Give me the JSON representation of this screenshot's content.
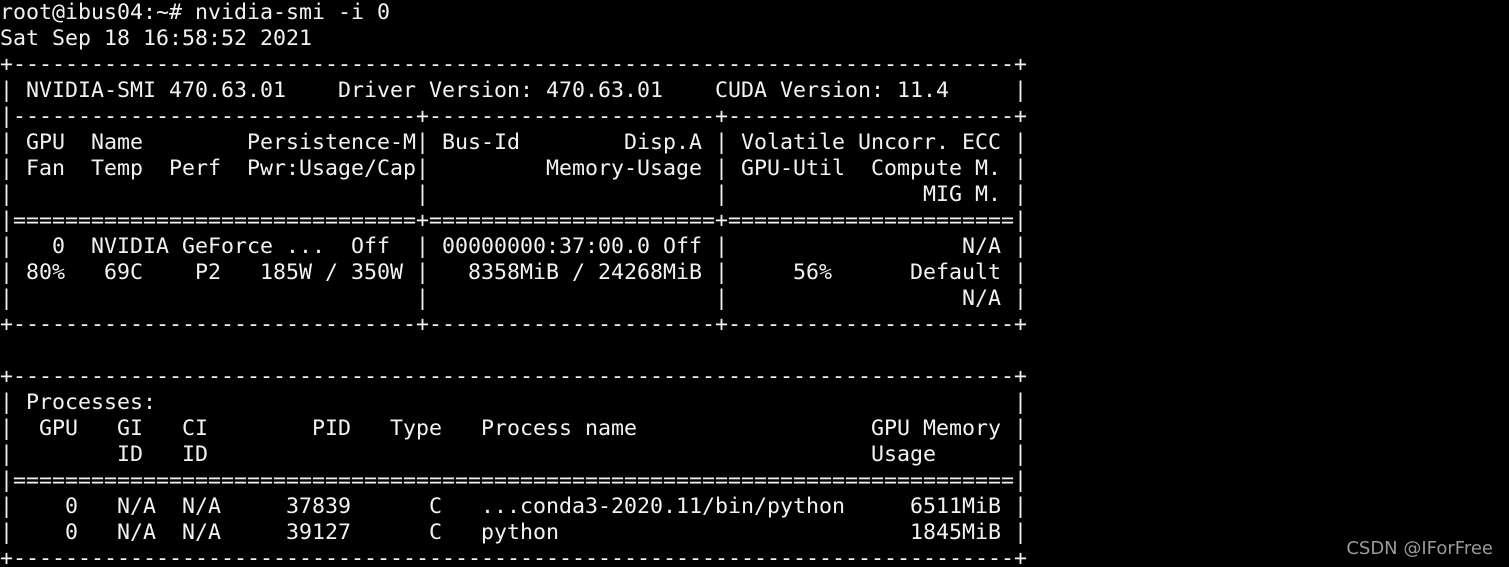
{
  "terminal": {
    "background": "#000000",
    "foreground": "#f2f2f2",
    "prompt": "root@ibus04:~#",
    "command": "nvidia-smi -i 0",
    "lines": [
      "root@ibus04:~# nvidia-smi -i 0",
      "Sat Sep 18 16:58:52 2021",
      "+-----------------------------------------------------------------------------+",
      "| NVIDIA-SMI 470.63.01    Driver Version: 470.63.01    CUDA Version: 11.4     |",
      "|-------------------------------+----------------------+----------------------+",
      "| GPU  Name        Persistence-M| Bus-Id        Disp.A | Volatile Uncorr. ECC |",
      "| Fan  Temp  Perf  Pwr:Usage/Cap|         Memory-Usage | GPU-Util  Compute M. |",
      "|                               |                      |               MIG M. |",
      "|===============================+======================+======================|",
      "|   0  NVIDIA GeForce ...  Off  | 00000000:37:00.0 Off |                  N/A |",
      "| 80%   69C    P2   185W / 350W |   8358MiB / 24268MiB |     56%      Default |",
      "|                               |                      |                  N/A |",
      "+-------------------------------+----------------------+----------------------+",
      "",
      "+-----------------------------------------------------------------------------+",
      "| Processes:                                                                  |",
      "|  GPU   GI   CI        PID   Type   Process name                  GPU Memory |",
      "|        ID   ID                                                   Usage      |",
      "|=============================================================================|",
      "|    0   N/A  N/A     37839      C   ...conda3-2020.11/bin/python     6511MiB |",
      "|    0   N/A  N/A     39127      C   python                           1845MiB |",
      "+-----------------------------------------------------------------------------+"
    ]
  },
  "watermark": "CSDN @IForFree"
}
